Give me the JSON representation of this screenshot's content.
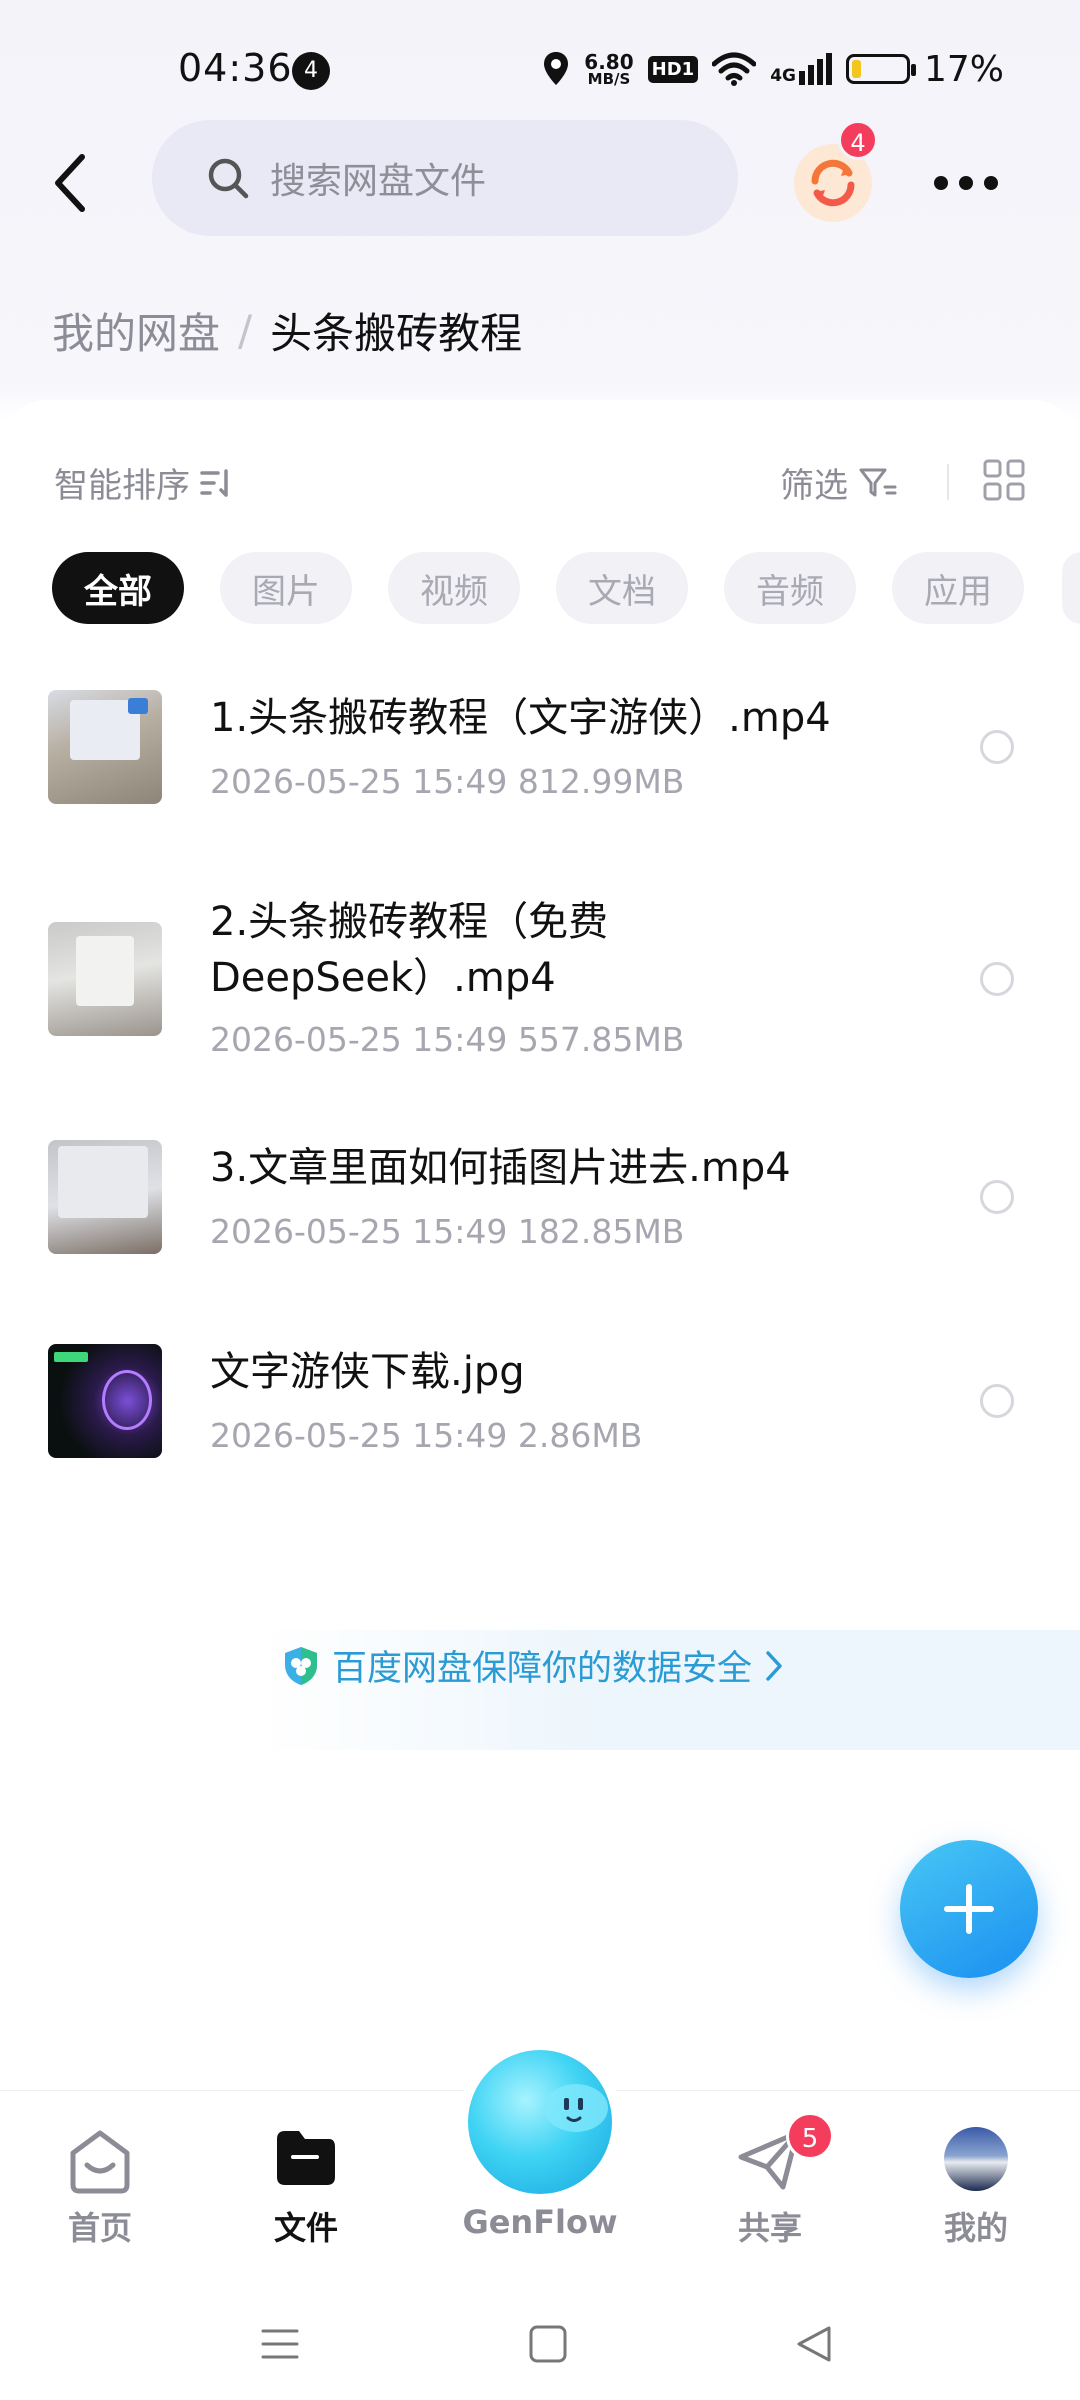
{
  "status_bar": {
    "time": "04:36",
    "notification_count": "4",
    "net_speed_value": "6.80",
    "net_speed_unit": "MB/S",
    "hd_label": "HD1",
    "signal_label": "4G",
    "battery_level": 0.17,
    "battery_text": "17%"
  },
  "header": {
    "search_placeholder": "搜索网盘文件",
    "sync_badge": "4"
  },
  "breadcrumb": {
    "root": "我的网盘",
    "separator": "/",
    "current": "头条搬砖教程"
  },
  "toolbar": {
    "sort_label": "智能排序",
    "filter_label": "筛选"
  },
  "filter_chips": [
    {
      "label": "全部",
      "active": true
    },
    {
      "label": "图片",
      "active": false
    },
    {
      "label": "视频",
      "active": false
    },
    {
      "label": "文档",
      "active": false
    },
    {
      "label": "音频",
      "active": false
    },
    {
      "label": "应用",
      "active": false
    }
  ],
  "files": [
    {
      "name": "1.头条搬砖教程（文字游侠）.mp4",
      "meta": "2026-05-25  15:49   812.99MB",
      "type": "video"
    },
    {
      "name": "2.头条搬砖教程（免费DeepSeek）.mp4",
      "meta": "2026-05-25  15:49   557.85MB",
      "type": "video"
    },
    {
      "name": "3.文章里面如何插图片进去.mp4",
      "meta": "2026-05-25  15:49   182.85MB",
      "type": "video"
    },
    {
      "name": "文字游侠下载.jpg",
      "meta": "2026-05-25  15:49   2.86MB",
      "type": "image"
    }
  ],
  "security_note": "百度网盘保障你的数据安全",
  "bottom_nav": {
    "home": "首页",
    "files": "文件",
    "genflow": "GenFlow",
    "share": "共享",
    "share_badge": "5",
    "mine": "我的"
  },
  "colors": {
    "accent_blue": "#2a9bd4",
    "badge_red": "#f43d5c",
    "fab_blue": "#1a8ff0",
    "battery_yellow": "#f4c51c"
  },
  "icons": [
    "back-arrow-icon",
    "search-icon",
    "sync-icon",
    "more-icon",
    "sort-icon",
    "filter-icon",
    "grid-view-icon",
    "shield-icon",
    "chevron-right-icon",
    "plus-icon",
    "home-icon",
    "folder-icon",
    "share-icon",
    "menu-icon",
    "square-icon",
    "triangle-back-icon"
  ]
}
